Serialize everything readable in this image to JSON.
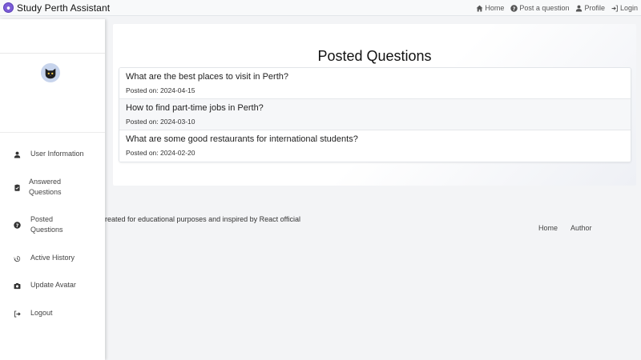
{
  "app": {
    "title": "Study Perth Assistant"
  },
  "nav": {
    "links": [
      {
        "label": "Home",
        "icon": "home-icon"
      },
      {
        "label": "Post a question",
        "icon": "question-circle-icon"
      },
      {
        "label": "Profile",
        "icon": "person-icon"
      },
      {
        "label": "Login",
        "icon": "login-icon"
      }
    ]
  },
  "sidebar": {
    "avatar_icon": "cat-avatar",
    "items": [
      {
        "label": "User Information",
        "icon": "person-icon"
      },
      {
        "label": "Answered Questions",
        "line1": "Answered",
        "line2": "Questions",
        "icon": "clipboard-check-icon"
      },
      {
        "label": "Posted Questions",
        "line1": "Posted",
        "line2": "Questions",
        "icon": "question-circle-icon"
      },
      {
        "label": "Active History",
        "icon": "history-icon"
      },
      {
        "label": "Update Avatar",
        "icon": "camera-icon"
      },
      {
        "label": "Logout",
        "icon": "logout-icon"
      }
    ]
  },
  "main": {
    "title": "Posted Questions",
    "questions": [
      {
        "title": "What are the best places to visit in Perth?",
        "date": "Posted on: 2024-04-15"
      },
      {
        "title": "How to find part-time jobs in Perth?",
        "date": "Posted on: 2024-03-10"
      },
      {
        "title": "What are some good restaurants for international students?",
        "date": "Posted on: 2024-02-20"
      }
    ]
  },
  "footer": {
    "text": "reated for educational purposes and inspired by React official",
    "links": [
      "Home",
      "Author"
    ]
  },
  "colors": {
    "brand": "#7b5cd6",
    "background": "#f3f4f6",
    "alt_row": "#f6f7f9"
  }
}
